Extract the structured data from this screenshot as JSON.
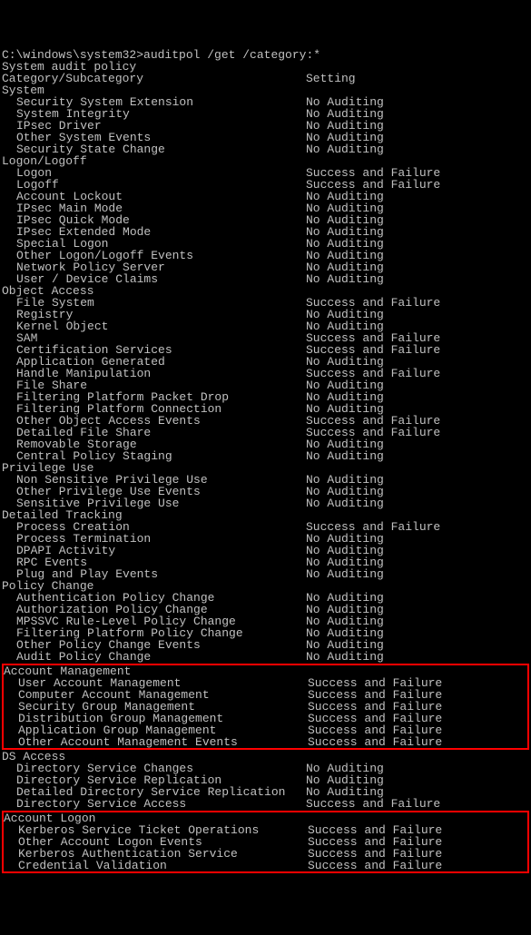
{
  "prompt": "C:\\windows\\system32>",
  "command": "auditpol /get /category:*",
  "header_line": "System audit policy",
  "col_headers": {
    "category": "Category/Subcategory",
    "setting": "Setting"
  },
  "sections": [
    {
      "name": "System",
      "highlighted": false,
      "items": [
        {
          "label": "Security System Extension",
          "setting": "No Auditing"
        },
        {
          "label": "System Integrity",
          "setting": "No Auditing"
        },
        {
          "label": "IPsec Driver",
          "setting": "No Auditing"
        },
        {
          "label": "Other System Events",
          "setting": "No Auditing"
        },
        {
          "label": "Security State Change",
          "setting": "No Auditing"
        }
      ]
    },
    {
      "name": "Logon/Logoff",
      "highlighted": false,
      "items": [
        {
          "label": "Logon",
          "setting": "Success and Failure"
        },
        {
          "label": "Logoff",
          "setting": "Success and Failure"
        },
        {
          "label": "Account Lockout",
          "setting": "No Auditing"
        },
        {
          "label": "IPsec Main Mode",
          "setting": "No Auditing"
        },
        {
          "label": "IPsec Quick Mode",
          "setting": "No Auditing"
        },
        {
          "label": "IPsec Extended Mode",
          "setting": "No Auditing"
        },
        {
          "label": "Special Logon",
          "setting": "No Auditing"
        },
        {
          "label": "Other Logon/Logoff Events",
          "setting": "No Auditing"
        },
        {
          "label": "Network Policy Server",
          "setting": "No Auditing"
        },
        {
          "label": "User / Device Claims",
          "setting": "No Auditing"
        }
      ]
    },
    {
      "name": "Object Access",
      "highlighted": false,
      "items": [
        {
          "label": "File System",
          "setting": "Success and Failure"
        },
        {
          "label": "Registry",
          "setting": "No Auditing"
        },
        {
          "label": "Kernel Object",
          "setting": "No Auditing"
        },
        {
          "label": "SAM",
          "setting": "Success and Failure"
        },
        {
          "label": "Certification Services",
          "setting": "Success and Failure"
        },
        {
          "label": "Application Generated",
          "setting": "No Auditing"
        },
        {
          "label": "Handle Manipulation",
          "setting": "Success and Failure"
        },
        {
          "label": "File Share",
          "setting": "No Auditing"
        },
        {
          "label": "Filtering Platform Packet Drop",
          "setting": "No Auditing"
        },
        {
          "label": "Filtering Platform Connection",
          "setting": "No Auditing"
        },
        {
          "label": "Other Object Access Events",
          "setting": "Success and Failure"
        },
        {
          "label": "Detailed File Share",
          "setting": "Success and Failure"
        },
        {
          "label": "Removable Storage",
          "setting": "No Auditing"
        },
        {
          "label": "Central Policy Staging",
          "setting": "No Auditing"
        }
      ]
    },
    {
      "name": "Privilege Use",
      "highlighted": false,
      "items": [
        {
          "label": "Non Sensitive Privilege Use",
          "setting": "No Auditing"
        },
        {
          "label": "Other Privilege Use Events",
          "setting": "No Auditing"
        },
        {
          "label": "Sensitive Privilege Use",
          "setting": "No Auditing"
        }
      ]
    },
    {
      "name": "Detailed Tracking",
      "highlighted": false,
      "items": [
        {
          "label": "Process Creation",
          "setting": "Success and Failure"
        },
        {
          "label": "Process Termination",
          "setting": "No Auditing"
        },
        {
          "label": "DPAPI Activity",
          "setting": "No Auditing"
        },
        {
          "label": "RPC Events",
          "setting": "No Auditing"
        },
        {
          "label": "Plug and Play Events",
          "setting": "No Auditing"
        }
      ]
    },
    {
      "name": "Policy Change",
      "highlighted": false,
      "items": [
        {
          "label": "Authentication Policy Change",
          "setting": "No Auditing"
        },
        {
          "label": "Authorization Policy Change",
          "setting": "No Auditing"
        },
        {
          "label": "MPSSVC Rule-Level Policy Change",
          "setting": "No Auditing"
        },
        {
          "label": "Filtering Platform Policy Change",
          "setting": "No Auditing"
        },
        {
          "label": "Other Policy Change Events",
          "setting": "No Auditing"
        },
        {
          "label": "Audit Policy Change",
          "setting": "No Auditing"
        }
      ]
    },
    {
      "name": "Account Management",
      "highlighted": true,
      "items": [
        {
          "label": "User Account Management",
          "setting": "Success and Failure"
        },
        {
          "label": "Computer Account Management",
          "setting": "Success and Failure"
        },
        {
          "label": "Security Group Management",
          "setting": "Success and Failure"
        },
        {
          "label": "Distribution Group Management",
          "setting": "Success and Failure"
        },
        {
          "label": "Application Group Management",
          "setting": "Success and Failure"
        },
        {
          "label": "Other Account Management Events",
          "setting": "Success and Failure"
        }
      ]
    },
    {
      "name": "DS Access",
      "highlighted": false,
      "items": [
        {
          "label": "Directory Service Changes",
          "setting": "No Auditing"
        },
        {
          "label": "Directory Service Replication",
          "setting": "No Auditing"
        },
        {
          "label": "Detailed Directory Service Replication",
          "setting": "No Auditing"
        },
        {
          "label": "Directory Service Access",
          "setting": "Success and Failure"
        }
      ]
    },
    {
      "name": "Account Logon",
      "highlighted": true,
      "items": [
        {
          "label": "Kerberos Service Ticket Operations",
          "setting": "Success and Failure"
        },
        {
          "label": "Other Account Logon Events",
          "setting": "Success and Failure"
        },
        {
          "label": "Kerberos Authentication Service",
          "setting": "Success and Failure"
        },
        {
          "label": "Credential Validation",
          "setting": "Success and Failure"
        }
      ]
    }
  ]
}
